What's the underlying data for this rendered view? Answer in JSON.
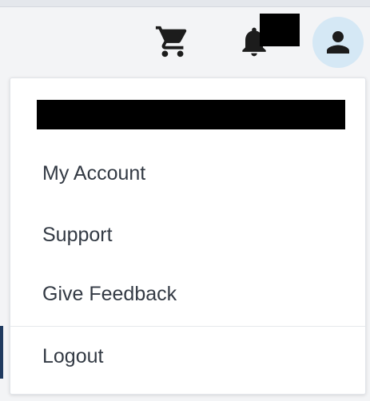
{
  "header": {
    "cart_icon": "shopping-cart-icon",
    "bell_icon": "bell-icon",
    "avatar_icon": "user-icon",
    "avatar_bg": "#d5e8f5",
    "icon_color": "#1c1c1c"
  },
  "menu": {
    "items": [
      {
        "label": "My Account"
      },
      {
        "label": "Support"
      },
      {
        "label": "Give Feedback"
      }
    ],
    "logout_label": "Logout"
  }
}
